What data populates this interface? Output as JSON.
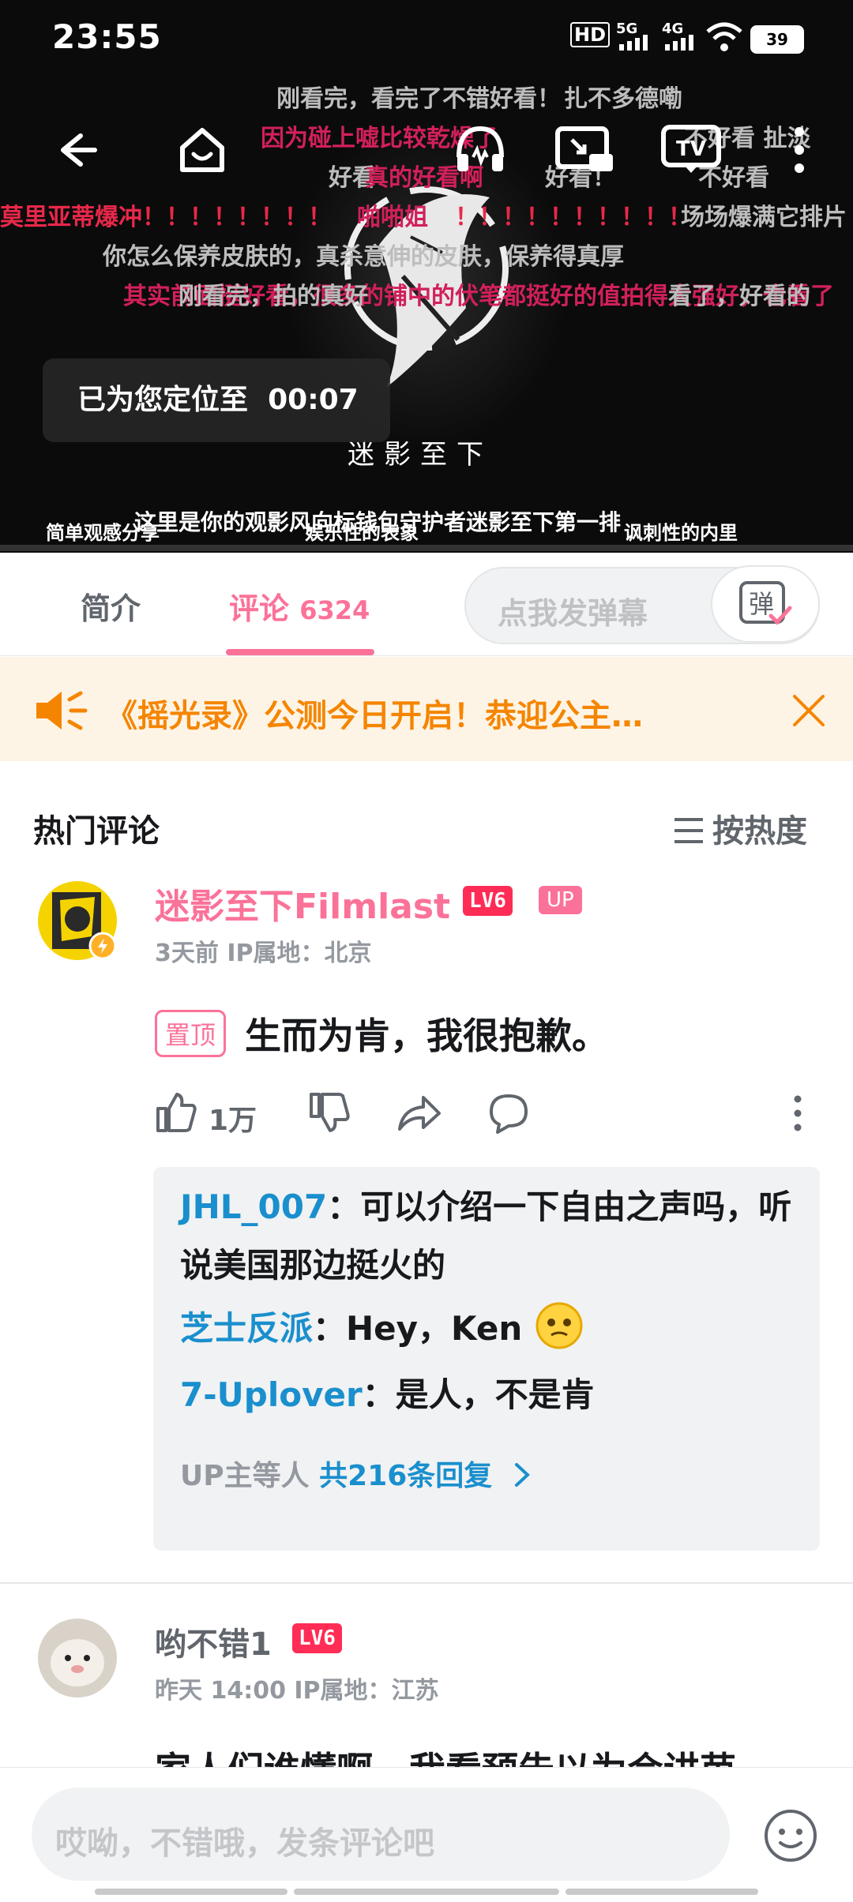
{
  "status_bar": {
    "time": "23:55",
    "hd": "HD",
    "net1": "5G",
    "net2": "4G",
    "battery": "39"
  },
  "video": {
    "toolbar": {
      "back": "back-arrow-icon",
      "home": "home-face-icon",
      "listen": "headphones-icon",
      "cast": "cast-icon",
      "tv": "TV",
      "more": "more-vertical-icon"
    },
    "danmaku": [
      {
        "text": "刚看完，看完了不错好看！",
        "color": "#bdbdbd"
      },
      {
        "text": "扎不多德嘞",
        "color": "#bdbdbd"
      },
      {
        "text": "因为碰上嘘比较乾燥了",
        "color": "#d1205a"
      },
      {
        "text": "不好看 扯淡",
        "color": "#bdbdbd"
      },
      {
        "text": "好看",
        "color": "#bdbdbd"
      },
      {
        "text": "真的好看啊",
        "color": "#d1205a"
      },
      {
        "text": "好看！",
        "color": "#bdbdbd"
      },
      {
        "text": "不好看",
        "color": "#bdbdbd"
      },
      {
        "text": "莫里亚蒂爆冲！！！！！！！！",
        "color": "#e8284a"
      },
      {
        "text": "啪啪姐",
        "color": "#d1205a"
      },
      {
        "text": "！！！！！！！！！！",
        "color": "#e8284a"
      },
      {
        "text": "场场爆满它排片",
        "color": "#bdbdbd"
      },
      {
        "text": "你怎么保养皮肤的，真杀意伸的皮肤，保养得真厚",
        "color": "#bdbdbd"
      },
      {
        "text": "其实前面挺好看，很多的铺中的伏笔都挺好的值拍得大强好，也看了",
        "color": "#d1205a"
      },
      {
        "text": "刚看完，拍的真好",
        "color": "#bdbdbd"
      },
      {
        "text": "看了，好看的",
        "color": "#bdbdbd"
      }
    ],
    "logo_text": "迷影至下",
    "locate_text": "已为您定位至",
    "locate_time": "00:07",
    "subtitles": [
      "简单观感分享",
      "娱乐性的表象",
      "这里是你的观影风向标钱包守护者迷影至下第一排",
      "讽刺性的内里"
    ]
  },
  "tabs": {
    "intro": "简介",
    "comments": "评论",
    "comment_count": "6324",
    "danmaku_placeholder": "点我发弹幕",
    "danmaku_btn": "弹"
  },
  "notice": {
    "text": "《摇光录》公测今日开启！恭迎公主…",
    "icon": "speaker-icon",
    "close": "close-icon"
  },
  "comments": {
    "section_title": "热门评论",
    "sort_label": "按热度",
    "items": [
      {
        "user": "迷影至下Filmlast",
        "level": "LV6",
        "badge": "UP",
        "meta": "3天前  IP属地：北京",
        "pinned": "置顶",
        "content": "生而为肯，我很抱歉。",
        "likes": "1万",
        "replies": [
          {
            "name": "JHL_007",
            "text": "：可以介绍一下自由之声吗，听说美国那边挺火的"
          },
          {
            "name": "芝士反派",
            "text": "：Hey，Ken"
          },
          {
            "name": "7-Uplover",
            "text": "：是人，不是肯"
          }
        ],
        "reply_summary_prefix": "UP主等人 ",
        "reply_summary_count": "共216条回复"
      },
      {
        "user": "哟不错1",
        "level": "LV6",
        "meta": "昨天 14:00  IP属地：江苏",
        "content": "家人们谁懂啊，我看预告以为会讲芭"
      }
    ]
  },
  "bottom": {
    "placeholder": "哎呦，不错哦，发条评论吧",
    "emoji": "emoji-icon"
  }
}
